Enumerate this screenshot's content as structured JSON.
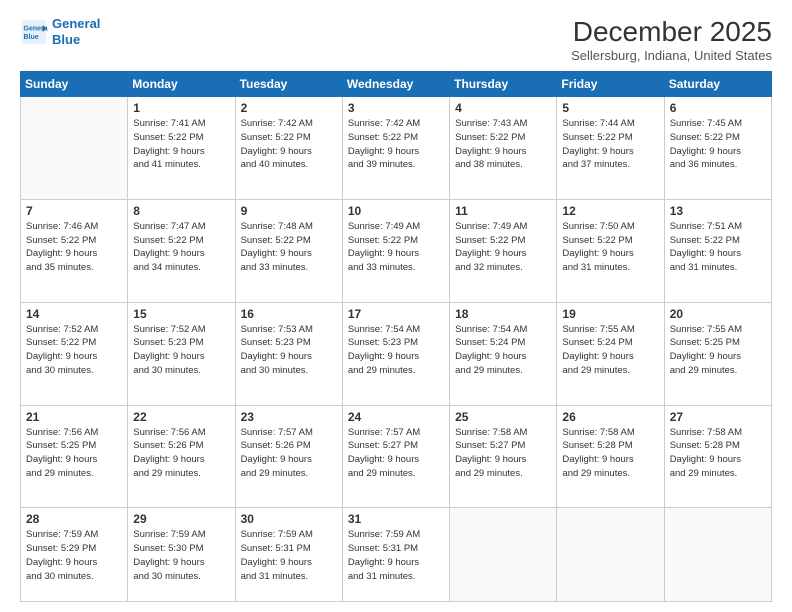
{
  "header": {
    "logo_line1": "General",
    "logo_line2": "Blue",
    "month_title": "December 2025",
    "location": "Sellersburg, Indiana, United States"
  },
  "days_of_week": [
    "Sunday",
    "Monday",
    "Tuesday",
    "Wednesday",
    "Thursday",
    "Friday",
    "Saturday"
  ],
  "weeks": [
    [
      {
        "day": "",
        "info": ""
      },
      {
        "day": "1",
        "info": "Sunrise: 7:41 AM\nSunset: 5:22 PM\nDaylight: 9 hours\nand 41 minutes."
      },
      {
        "day": "2",
        "info": "Sunrise: 7:42 AM\nSunset: 5:22 PM\nDaylight: 9 hours\nand 40 minutes."
      },
      {
        "day": "3",
        "info": "Sunrise: 7:42 AM\nSunset: 5:22 PM\nDaylight: 9 hours\nand 39 minutes."
      },
      {
        "day": "4",
        "info": "Sunrise: 7:43 AM\nSunset: 5:22 PM\nDaylight: 9 hours\nand 38 minutes."
      },
      {
        "day": "5",
        "info": "Sunrise: 7:44 AM\nSunset: 5:22 PM\nDaylight: 9 hours\nand 37 minutes."
      },
      {
        "day": "6",
        "info": "Sunrise: 7:45 AM\nSunset: 5:22 PM\nDaylight: 9 hours\nand 36 minutes."
      }
    ],
    [
      {
        "day": "7",
        "info": "Sunrise: 7:46 AM\nSunset: 5:22 PM\nDaylight: 9 hours\nand 35 minutes."
      },
      {
        "day": "8",
        "info": "Sunrise: 7:47 AM\nSunset: 5:22 PM\nDaylight: 9 hours\nand 34 minutes."
      },
      {
        "day": "9",
        "info": "Sunrise: 7:48 AM\nSunset: 5:22 PM\nDaylight: 9 hours\nand 33 minutes."
      },
      {
        "day": "10",
        "info": "Sunrise: 7:49 AM\nSunset: 5:22 PM\nDaylight: 9 hours\nand 33 minutes."
      },
      {
        "day": "11",
        "info": "Sunrise: 7:49 AM\nSunset: 5:22 PM\nDaylight: 9 hours\nand 32 minutes."
      },
      {
        "day": "12",
        "info": "Sunrise: 7:50 AM\nSunset: 5:22 PM\nDaylight: 9 hours\nand 31 minutes."
      },
      {
        "day": "13",
        "info": "Sunrise: 7:51 AM\nSunset: 5:22 PM\nDaylight: 9 hours\nand 31 minutes."
      }
    ],
    [
      {
        "day": "14",
        "info": "Sunrise: 7:52 AM\nSunset: 5:22 PM\nDaylight: 9 hours\nand 30 minutes."
      },
      {
        "day": "15",
        "info": "Sunrise: 7:52 AM\nSunset: 5:23 PM\nDaylight: 9 hours\nand 30 minutes."
      },
      {
        "day": "16",
        "info": "Sunrise: 7:53 AM\nSunset: 5:23 PM\nDaylight: 9 hours\nand 30 minutes."
      },
      {
        "day": "17",
        "info": "Sunrise: 7:54 AM\nSunset: 5:23 PM\nDaylight: 9 hours\nand 29 minutes."
      },
      {
        "day": "18",
        "info": "Sunrise: 7:54 AM\nSunset: 5:24 PM\nDaylight: 9 hours\nand 29 minutes."
      },
      {
        "day": "19",
        "info": "Sunrise: 7:55 AM\nSunset: 5:24 PM\nDaylight: 9 hours\nand 29 minutes."
      },
      {
        "day": "20",
        "info": "Sunrise: 7:55 AM\nSunset: 5:25 PM\nDaylight: 9 hours\nand 29 minutes."
      }
    ],
    [
      {
        "day": "21",
        "info": "Sunrise: 7:56 AM\nSunset: 5:25 PM\nDaylight: 9 hours\nand 29 minutes."
      },
      {
        "day": "22",
        "info": "Sunrise: 7:56 AM\nSunset: 5:26 PM\nDaylight: 9 hours\nand 29 minutes."
      },
      {
        "day": "23",
        "info": "Sunrise: 7:57 AM\nSunset: 5:26 PM\nDaylight: 9 hours\nand 29 minutes."
      },
      {
        "day": "24",
        "info": "Sunrise: 7:57 AM\nSunset: 5:27 PM\nDaylight: 9 hours\nand 29 minutes."
      },
      {
        "day": "25",
        "info": "Sunrise: 7:58 AM\nSunset: 5:27 PM\nDaylight: 9 hours\nand 29 minutes."
      },
      {
        "day": "26",
        "info": "Sunrise: 7:58 AM\nSunset: 5:28 PM\nDaylight: 9 hours\nand 29 minutes."
      },
      {
        "day": "27",
        "info": "Sunrise: 7:58 AM\nSunset: 5:28 PM\nDaylight: 9 hours\nand 29 minutes."
      }
    ],
    [
      {
        "day": "28",
        "info": "Sunrise: 7:59 AM\nSunset: 5:29 PM\nDaylight: 9 hours\nand 30 minutes."
      },
      {
        "day": "29",
        "info": "Sunrise: 7:59 AM\nSunset: 5:30 PM\nDaylight: 9 hours\nand 30 minutes."
      },
      {
        "day": "30",
        "info": "Sunrise: 7:59 AM\nSunset: 5:31 PM\nDaylight: 9 hours\nand 31 minutes."
      },
      {
        "day": "31",
        "info": "Sunrise: 7:59 AM\nSunset: 5:31 PM\nDaylight: 9 hours\nand 31 minutes."
      },
      {
        "day": "",
        "info": ""
      },
      {
        "day": "",
        "info": ""
      },
      {
        "day": "",
        "info": ""
      }
    ]
  ]
}
